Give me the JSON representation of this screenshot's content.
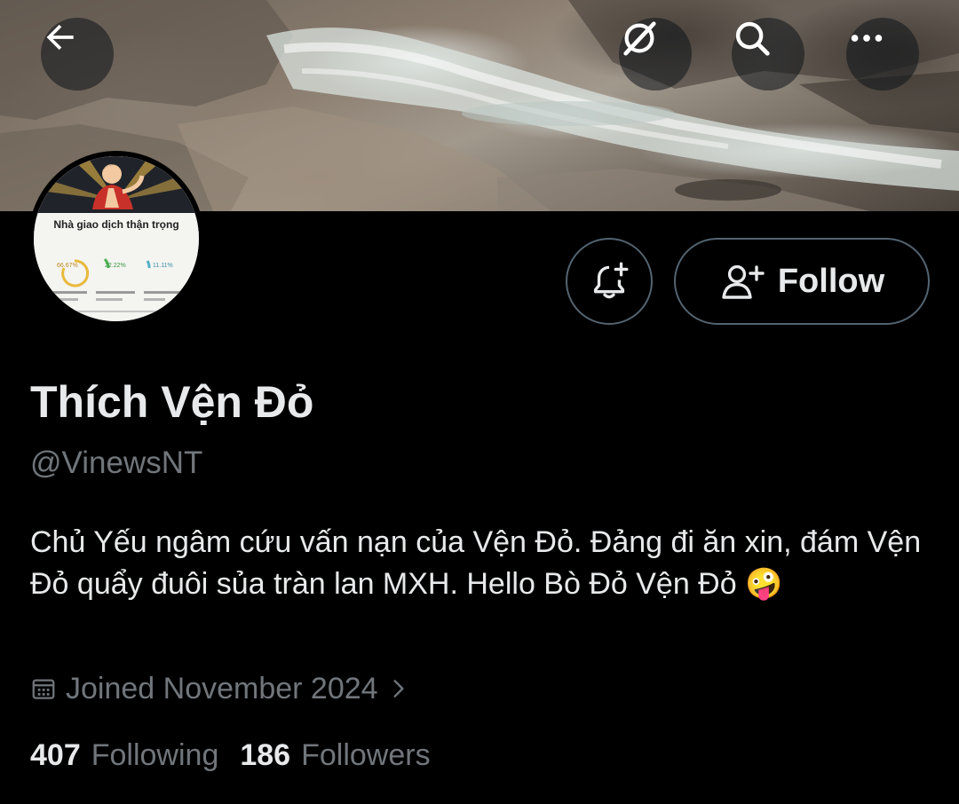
{
  "header": {
    "back_icon": "back-arrow-icon",
    "grok_icon": "grok-icon",
    "search_icon": "search-icon",
    "more_icon": "more-icon"
  },
  "avatar": {
    "image_title": "Nhà giao dịch thận trọng",
    "percent_1": "66.67%",
    "percent_2": "22.22%",
    "percent_3": "11.11%"
  },
  "actions": {
    "notify_icon": "bell-plus-icon",
    "follow_icon": "person-add-icon",
    "follow_label": "Follow"
  },
  "profile": {
    "display_name": "Thích Vện Đỏ",
    "handle": "@VinewsNT",
    "bio": "Chủ Yếu ngâm cứu vấn nạn của Vện Đỏ. Đảng đi ăn xin, đám Vện Đỏ quẩy đuôi sủa tràn lan MXH. Hello Bò Đỏ Vện Đỏ 🤪",
    "joined": "Joined November 2024",
    "following_count": "407",
    "following_label": "Following",
    "followers_count": "186",
    "followers_label": "Followers"
  },
  "colors": {
    "background": "#000000",
    "text_primary": "#e7e9ea",
    "text_secondary": "#71767b",
    "border": "#536471"
  }
}
